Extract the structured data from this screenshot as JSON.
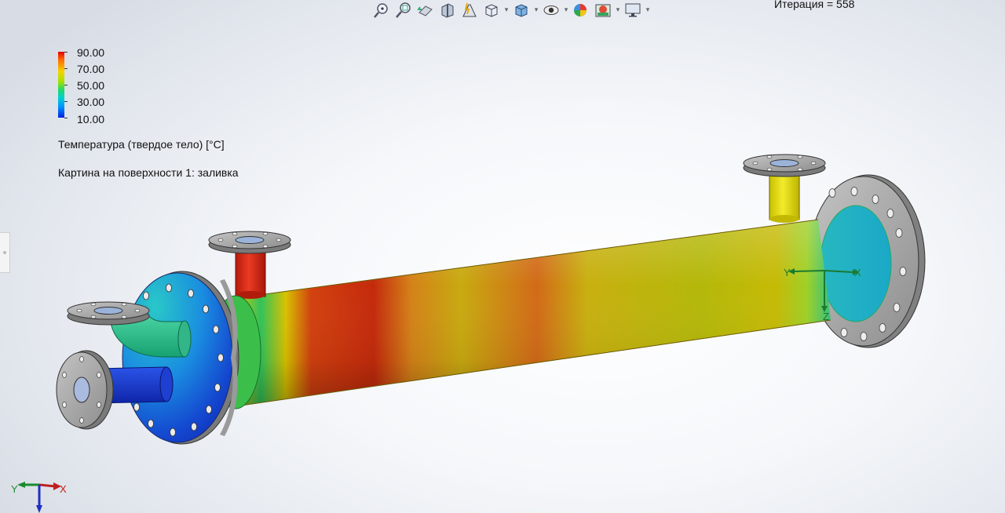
{
  "status": {
    "iteration": "Итерация = 558"
  },
  "legend": {
    "ticks": [
      "90.00",
      "70.00",
      "50.00",
      "30.00",
      "10.00"
    ],
    "quantity": "Температура (твердое тело) [°C]",
    "plot": "Картина на поверхности 1: заливка"
  },
  "triad": {
    "x": "X",
    "y": "Y",
    "z": "Z"
  },
  "colors": {
    "hot": "#d8230f",
    "warm": "#c9b300",
    "cool": "#1fc7c0",
    "cold": "#1030c8",
    "flange": "#a7a7a7"
  },
  "toolbar": {
    "icons": [
      "zoom-to-fit-icon",
      "zoom-to-area-icon",
      "previous-view-icon",
      "section-view-icon",
      "dynamic-annotation-icon",
      "view-orientation-icon",
      "display-style-icon",
      "hide-show-icon",
      "edit-appearance-icon",
      "apply-scene-icon",
      "view-settings-icon"
    ]
  }
}
